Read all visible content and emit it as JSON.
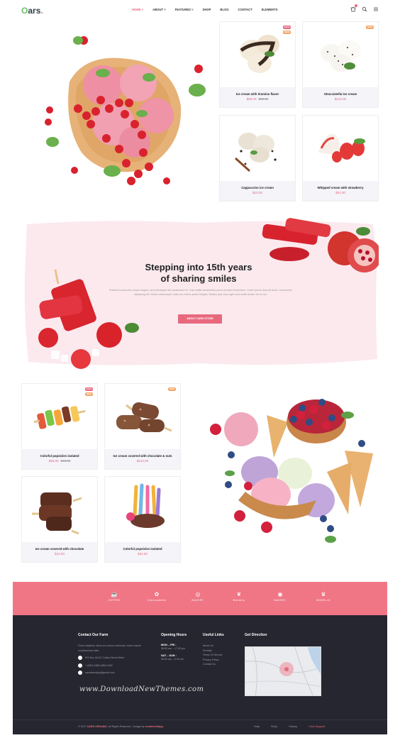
{
  "header": {
    "logo": {
      "initial": "O",
      "rest": "ars",
      "dot": "."
    },
    "nav": [
      "HOME ˅",
      "ABOUT ˅",
      "FEATURES ˅",
      "SHOP",
      "BLOG",
      "CONTACT",
      "ELEMENTS"
    ],
    "icons": [
      "cart-icon",
      "search-icon",
      "menu-icon"
    ]
  },
  "products_top": [
    {
      "name": "Ice cream with tiramisu flavor",
      "price": "$58.00",
      "old_price": "$60.00",
      "badges": [
        "SALE",
        "NEW"
      ]
    },
    {
      "name": "Stracciatella ice cream",
      "price": "$143.00",
      "old_price": "",
      "badges": [
        "NEW"
      ]
    },
    {
      "name": "Cappuccino ice cream",
      "price": "$13.00",
      "old_price": "",
      "badges": []
    },
    {
      "name": "Whipped cream with strawberry",
      "price": "$31.00",
      "old_price": "",
      "badges": []
    }
  ],
  "promo": {
    "title_line1": "Stepping into 15th  years",
    "title_line2": "of sharing smiles",
    "text": "Praesent commodo cursus magna, vel scelerisque nisl consectetur et. Cras mattis consectetur purus sit amet fermentum. Lorem ipsum dolor sit amet, consectetur adipiscing elit. Donec ullamcorper nulla non metus auctor fringilla. Nullam quis risus eget urna mollis ornare vel eu leo.",
    "button": "ABOUT OARS STORE"
  },
  "products_bottom": [
    {
      "name": "Colorful popsicles isolated",
      "price": "$58.00",
      "old_price": "$60.00",
      "badges": [
        "SALE",
        "NEW"
      ]
    },
    {
      "name": "Ice cream covered with chocolate & nuts",
      "price": "$142.00",
      "old_price": "",
      "badges": [
        "NEW"
      ]
    },
    {
      "name": "Ice cream covered with chocolate",
      "price": "$13.00",
      "old_price": "",
      "badges": []
    },
    {
      "name": "Colorful popsicles isolated",
      "price": "$31.00",
      "old_price": "",
      "badges": []
    }
  ],
  "brands": [
    "COFFEE",
    "Ciboncadette",
    "BAKERY",
    "Mondelo",
    "BAKERY",
    "MOHELLE"
  ],
  "footer": {
    "contact": {
      "title": "Contact Our Farm",
      "desc": "Fusce dapibus, tellus ac cursus commodo, tortor mauris condimentum nibh.",
      "address": "PO Box 16122 Collins Street West",
      "phone": "+ (082) 1889 1884 0169",
      "email": "oarsdesertjoy@gmail.com"
    },
    "hours": {
      "title": "Opening Hours",
      "d1": "MON – FRI :",
      "t1": "08:00 am – 17:00 pm",
      "d2": "SAT – SUN :",
      "t2": "08:00 am – 5:30 am"
    },
    "links": {
      "title": "Useful Links",
      "items": [
        "About Us",
        "Portfolio",
        "Terms Of Service",
        "Privacy Policy",
        "Contact Us"
      ]
    },
    "direction": {
      "title": "Get Direction"
    },
    "watermark": "www.DownloadNewThemes.com",
    "copyright_pre": "© 2017 ",
    "copyright_brand": "OARS ORGANIC",
    "copyright_mid": ". All Rights Reserved . Design by ",
    "copyright_author": "creativewithjoy",
    "bottom_links": [
      "Help",
      "FAQs",
      "History",
      "Clina Support"
    ]
  },
  "colors": {
    "accent": "#e8697e",
    "brandbar": "#f07585",
    "footer": "#262630",
    "promo_bg": "#fbe9ee"
  }
}
